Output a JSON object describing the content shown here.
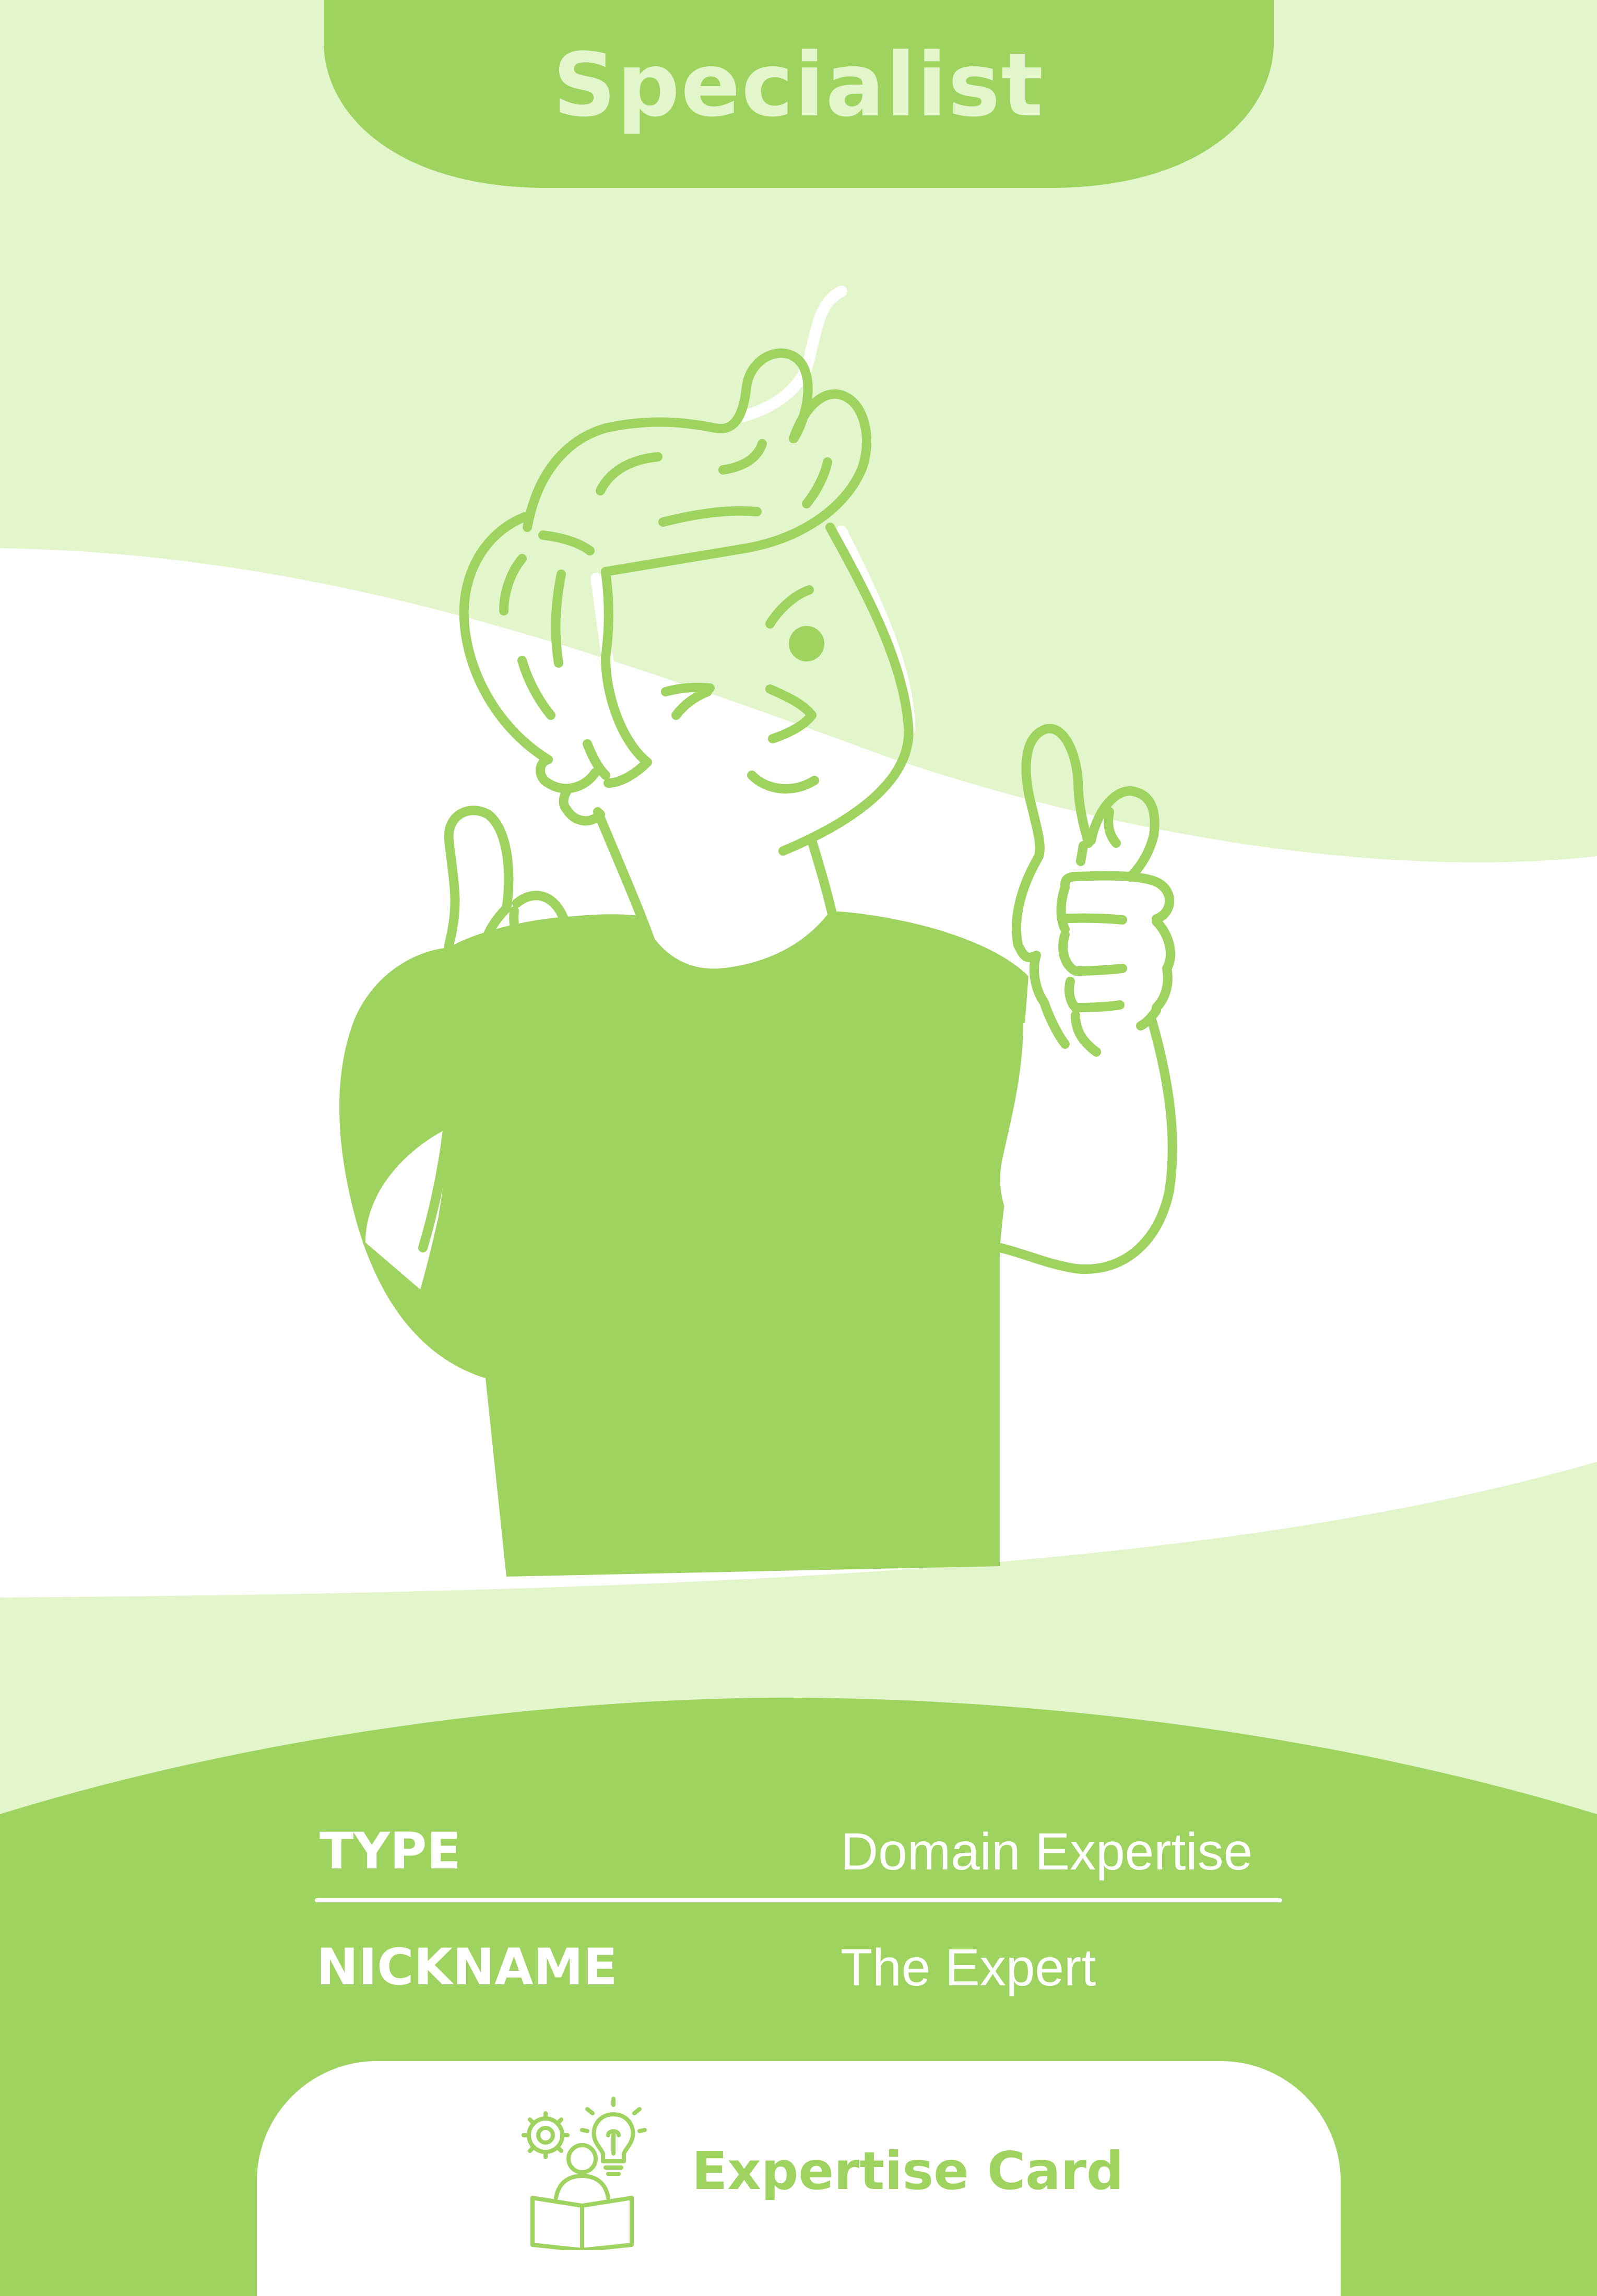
{
  "card": {
    "title": "Specialist",
    "rows": [
      {
        "label": "TYPE",
        "value": "Domain Expertise"
      },
      {
        "label": "NICKNAME",
        "value": "The Expert"
      }
    ],
    "footer": {
      "label": "Expertise Card",
      "icon": "expertise-icon"
    }
  },
  "colors": {
    "primary_green": "#9fd35f",
    "light_green": "#e2f5cb",
    "white": "#ffffff"
  },
  "illustration": "person-thumbs-up-icon"
}
